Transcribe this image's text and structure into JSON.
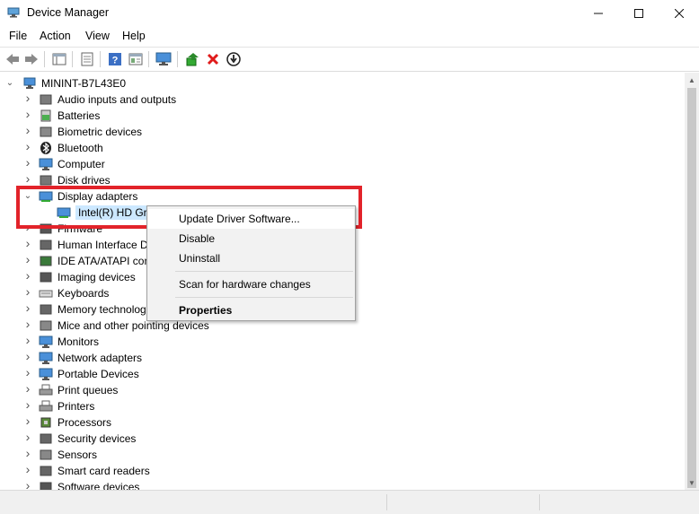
{
  "window": {
    "title": "Device Manager",
    "controls": {
      "minimize": "—",
      "maximize": "☐",
      "close": "✕"
    }
  },
  "menu": [
    "File",
    "Action",
    "View",
    "Help"
  ],
  "toolbar": {
    "buttons": [
      "back-arrow-icon",
      "forward-arrow-icon",
      "tree-view-icon",
      "properties-icon",
      "help-icon",
      "view-icon",
      "scan-hardware-icon",
      "update-driver-icon",
      "uninstall-icon",
      "disable-icon"
    ]
  },
  "tree": {
    "root": "MININT-B7L43E0",
    "categories": [
      {
        "label": "Audio inputs and outputs",
        "icon": "speaker-icon"
      },
      {
        "label": "Batteries",
        "icon": "battery-icon"
      },
      {
        "label": "Biometric devices",
        "icon": "biometric-icon"
      },
      {
        "label": "Bluetooth",
        "icon": "bluetooth-icon"
      },
      {
        "label": "Computer",
        "icon": "computer-icon"
      },
      {
        "label": "Disk drives",
        "icon": "disk-icon"
      },
      {
        "label": "Display adapters",
        "icon": "display-adapter-icon",
        "expanded": true
      },
      {
        "label": "Intel(R) HD Gra",
        "icon": "display-adapter-icon",
        "child": true,
        "selected": true
      },
      {
        "label": "Firmware",
        "icon": "firmware-icon"
      },
      {
        "label": "Human Interface D",
        "icon": "hid-icon"
      },
      {
        "label": "IDE ATA/ATAPI con",
        "icon": "ide-icon"
      },
      {
        "label": "Imaging devices",
        "icon": "camera-icon"
      },
      {
        "label": "Keyboards",
        "icon": "keyboard-icon"
      },
      {
        "label": "Memory technolog",
        "icon": "memory-icon"
      },
      {
        "label": "Mice and other pointing devices",
        "icon": "mouse-icon"
      },
      {
        "label": "Monitors",
        "icon": "monitor-icon"
      },
      {
        "label": "Network adapters",
        "icon": "network-icon"
      },
      {
        "label": "Portable Devices",
        "icon": "portable-icon"
      },
      {
        "label": "Print queues",
        "icon": "print-queue-icon"
      },
      {
        "label": "Printers",
        "icon": "printer-icon"
      },
      {
        "label": "Processors",
        "icon": "processor-icon"
      },
      {
        "label": "Security devices",
        "icon": "security-icon"
      },
      {
        "label": "Sensors",
        "icon": "sensor-icon"
      },
      {
        "label": "Smart card readers",
        "icon": "smartcard-icon"
      },
      {
        "label": "Software devices",
        "icon": "software-icon"
      }
    ]
  },
  "context_menu": {
    "update_driver": "Update Driver Software...",
    "disable": "Disable",
    "uninstall": "Uninstall",
    "scan": "Scan for hardware changes",
    "properties": "Properties"
  },
  "colors": {
    "highlight_border": "#e2232a",
    "selection": "#cce8ff"
  }
}
